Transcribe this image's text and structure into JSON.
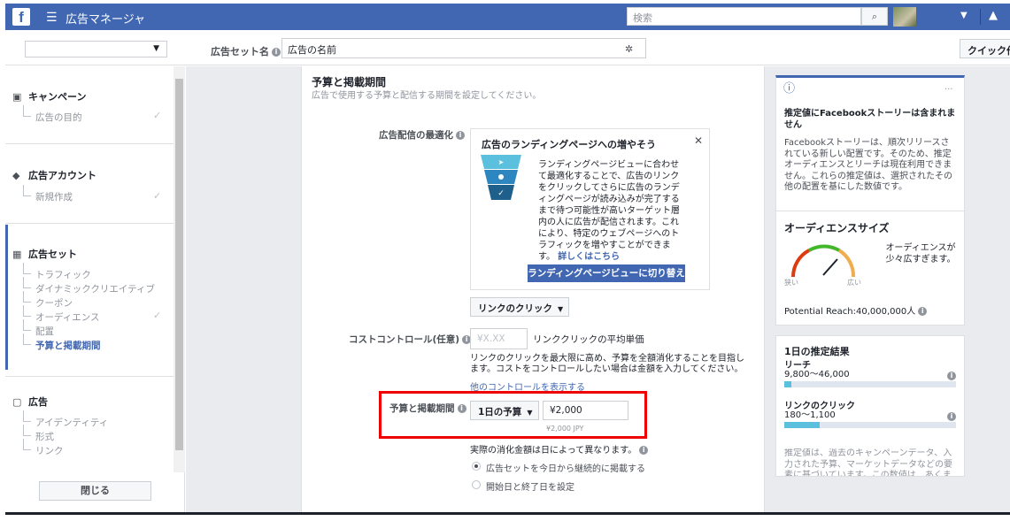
{
  "topbar": {
    "logo": "f",
    "menu_icon": "☰",
    "title": "広告マネージャ",
    "search_placeholder": "検索",
    "search_icon": "search-icon",
    "caret": "▼",
    "bell": "🔔"
  },
  "subbar": {
    "adset_name_label": "広告セット名",
    "adset_name_value": "広告の名前",
    "quick_button": "クイック作"
  },
  "sidebar": {
    "campaign": {
      "label": "キャンペーン",
      "items": [
        "広告の目的"
      ]
    },
    "account": {
      "label": "広告アカウント",
      "items": [
        "新規作成"
      ]
    },
    "adset": {
      "label": "広告セット",
      "items": [
        "トラフィック",
        "ダイナミッククリエイティブ",
        "クーポン",
        "オーディエンス",
        "配置",
        "予算と掲載期間"
      ]
    },
    "ad": {
      "label": "広告",
      "items": [
        "アイデンティティ",
        "形式",
        "リンク"
      ]
    },
    "close_button": "閉じる"
  },
  "main": {
    "section_title": "予算と掲載期間",
    "section_desc": "広告で使用する予算と配信する期間を設定してください。",
    "optimization_label": "広告配信の最適化",
    "tip": {
      "title": "広告のランディングページへの増やそう",
      "body": "ランディングページビューに合わせて最適化することで、広告のリンクをクリックしてさらに広告のランディングページが読み込みが完了するまで待つ可能性が高いターゲット層内の人に広告が配信されます。これにより、特定のウェブページへのトラフィックを増やすことができます。",
      "link": "詳しくはこちら",
      "button": "ランディングページビューに切り替え"
    },
    "link_click_dropdown": "リンクのクリック",
    "cost_control_label": "コストコントロール(任意)",
    "cost_placeholder": "¥X.XX",
    "cost_unit": "リンククリックの平均単価",
    "cost_helper": "リンクのクリックを最大限に高め、予算を全額消化することを目指します。コストをコントロールしたい場合は金額を入力してください。",
    "more_controls_link": "他のコントロールを表示する",
    "budget_label": "予算と掲載期間",
    "budget_type": "1日の予算",
    "budget_value": "¥2,000",
    "budget_jpy": "¥2,000 JPY",
    "actual_spend_note": "実際の消化金額は日によって異なります。",
    "radio_continuous": "広告セットを今日から継続的に掲載する",
    "radio_dates": "開始日と終了日を設定"
  },
  "right": {
    "stories_card": {
      "title": "推定値にFacebookストーリーは含まれません",
      "body": "Facebookストーリーは、順次リリースされている新しい配置です。そのため、推定オーディエンスとリーチは現在利用できません。これらの推定値は、選択されたその他の配置を基にした数値です。",
      "more": "···"
    },
    "audience_card": {
      "title": "オーディエンスサイズ",
      "gauge_text": "オーディエンスが少々広すぎます。",
      "narrow": "狭い",
      "wide": "広い",
      "potential_reach": "Potential Reach:40,000,000人"
    },
    "results_card": {
      "title": "1日の推定結果",
      "reach_label": "リーチ",
      "reach_value": "9,800～46,000",
      "clicks_label": "リンクのクリック",
      "clicks_value": "180～1,100",
      "footnote": "推定値は、過去のキャンペーンデータ、入力された予算、マーケットデータなどの要素に基づいています。この数値は、あくまで指定"
    }
  },
  "colors": {
    "brand": "#4267b2",
    "highlight": "#ee0000",
    "bar": "#5bc0de"
  }
}
